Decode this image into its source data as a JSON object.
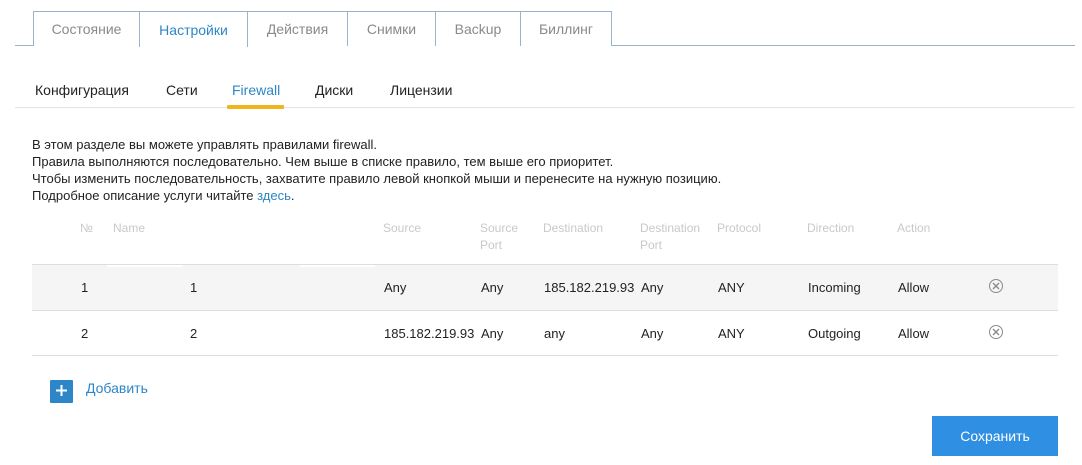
{
  "top_tabs": [
    {
      "label": "Состояние",
      "active": false
    },
    {
      "label": "Настройки",
      "active": true
    },
    {
      "label": "Действия",
      "active": false
    },
    {
      "label": "Снимки",
      "active": false
    },
    {
      "label": "Backup",
      "active": false
    },
    {
      "label": "Биллинг",
      "active": false
    }
  ],
  "sub_tabs": [
    {
      "label": "Конфигурация",
      "active": false
    },
    {
      "label": "Сети",
      "active": false
    },
    {
      "label": "Firewall",
      "active": true
    },
    {
      "label": "Диски",
      "active": false
    },
    {
      "label": "Лицензии",
      "active": false
    }
  ],
  "description": {
    "line1": "В этом разделе вы можете управлять правилами firewall.",
    "line2": "Правила выполняются последовательно. Чем выше в списке правило, тем выше его приоритет.",
    "line3": "Чтобы изменить последовательность, захватите правило левой кнопкой мыши и перенесите на нужную позицию.",
    "line4_prefix": "Подробное описание услуги читайте ",
    "line4_link": "здесь",
    "line4_suffix": "."
  },
  "table": {
    "headers": {
      "num": "№",
      "name": "Name",
      "source": "Source",
      "source_port_1": "Source",
      "source_port_2": "Port",
      "destination": "Destination",
      "destination_port_1": "Destination",
      "destination_port_2": "Port",
      "protocol": "Protocol",
      "direction": "Direction",
      "action": "Action"
    },
    "rows": [
      {
        "num": "1",
        "name": "1",
        "source": "Any",
        "source_port": "Any",
        "destination": "185.182.219.93",
        "destination_port": "Any",
        "protocol": "ANY",
        "direction": "Incoming",
        "action": "Allow"
      },
      {
        "num": "2",
        "name": "2",
        "source": "185.182.219.93",
        "source_port": "Any",
        "destination": "any",
        "destination_port": "Any",
        "protocol": "ANY",
        "direction": "Outgoing",
        "action": "Allow"
      }
    ]
  },
  "add_label": "Добавить",
  "save_label": "Сохранить",
  "colors": {
    "accent": "#2d86c7",
    "save_button": "#2f8fe2",
    "active_underline": "#f0b51c",
    "tab_border": "#9ab3c9"
  },
  "icons": {
    "add": "plus-icon",
    "delete": "close-circle-icon"
  }
}
